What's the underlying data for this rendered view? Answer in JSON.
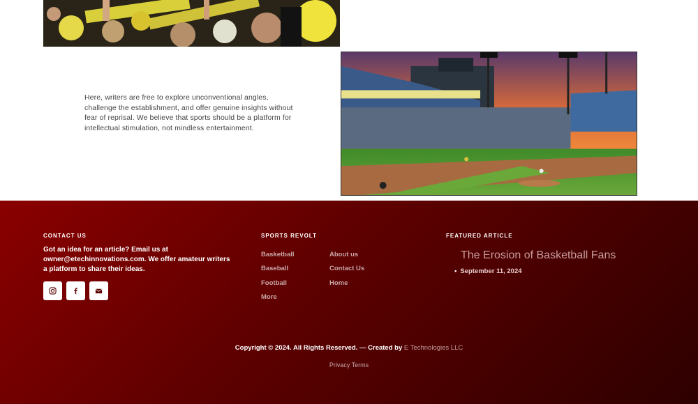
{
  "intro": {
    "text": "Here, writers are free to explore unconventional angles, challenge the establishment, and offer genuine insights without fear of reprisal. We believe that sports should be a platform for intellectual stimulation, not mindless entertainment."
  },
  "footer": {
    "contact": {
      "title": "CONTACT US",
      "text": "Got an idea for an article? Email us at owner@etechinnovations.com. We offer amateur writers a platform to share their ideas.",
      "social": [
        "instagram-icon",
        "facebook-icon",
        "envelope-icon"
      ]
    },
    "sports": {
      "title": "SPORTS REVOLT",
      "col1": [
        "Basketball",
        "Baseball",
        "Football",
        "More"
      ],
      "col2": [
        "About us",
        "Contact Us",
        "Home"
      ]
    },
    "featured": {
      "title": "FEATURED ARTICLE",
      "article_title": "The Erosion of Basketball Fans",
      "article_date": "September 11, 2024"
    },
    "copyright": {
      "prefix": "Copyright © 2024. All Rights Reserved. — Created by ",
      "company": "E Technologies LLC"
    },
    "legal": {
      "privacy": "Privacy",
      "terms": "Terms"
    }
  },
  "colors": {
    "footer_start": "#8a0000",
    "footer_end": "#2e0000",
    "link": "#c9a7a7"
  }
}
